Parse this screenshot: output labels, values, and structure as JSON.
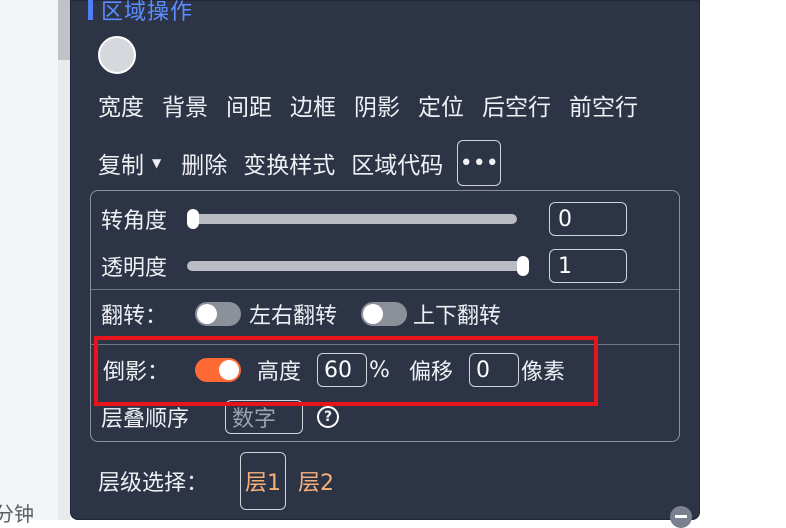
{
  "background": {
    "bottom_text": "分钟"
  },
  "panel": {
    "title": "区域操作",
    "menu": [
      "宽度",
      "背景",
      "间距",
      "边框",
      "阴影",
      "定位",
      "后空行",
      "前空行"
    ],
    "actions": {
      "copy": "复制",
      "delete": "删除",
      "change_style": "变换样式",
      "region_code": "区域代码",
      "more": "•••"
    },
    "rotation": {
      "label": "转角度",
      "value": "0",
      "level": 0
    },
    "opacity": {
      "label": "透明度",
      "value": "1",
      "level": 1
    },
    "flip": {
      "label": "翻转：",
      "horizontal": "左右翻转",
      "vertical": "上下翻转"
    },
    "reflection": {
      "label": "倒影：",
      "enabled": true,
      "height_label": "高度",
      "height_value": "60",
      "height_unit": "%",
      "offset_label": "偏移",
      "offset_value": "0",
      "offset_unit": "像素"
    },
    "stacking": {
      "label": "层叠顺序",
      "placeholder": "数字",
      "help": "?"
    },
    "layer": {
      "label": "层级选择：",
      "options": [
        "层1",
        "层2"
      ]
    }
  },
  "colors": {
    "panel": "#2c3446",
    "title": "#5d8cff",
    "toggle_on": "#ff6a34",
    "layer_text": "#f6b07a",
    "highlight": "#e8141b"
  }
}
